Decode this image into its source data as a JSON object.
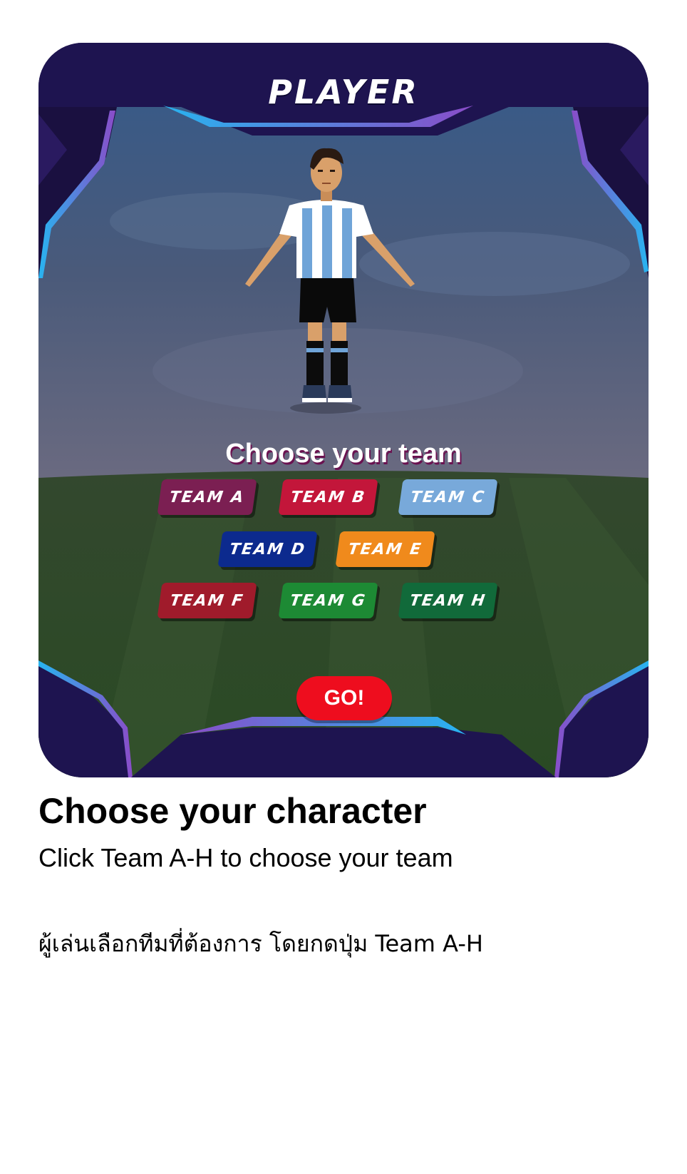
{
  "card": {
    "title": "PLAYER",
    "heading": "Choose your team",
    "teams": [
      {
        "label": "TEAM A",
        "color": "#7b1f52"
      },
      {
        "label": "TEAM B",
        "color": "#c3163a"
      },
      {
        "label": "TEAM C",
        "color": "#78a9da"
      },
      {
        "label": "TEAM D",
        "color": "#0c2a8e"
      },
      {
        "label": "TEAM E",
        "color": "#f08a1c"
      },
      {
        "label": "TEAM F",
        "color": "#a01b2b"
      },
      {
        "label": "TEAM G",
        "color": "#1d8a34"
      },
      {
        "label": "TEAM H",
        "color": "#116a3a"
      }
    ],
    "go_label": "GO!"
  },
  "caption": {
    "title": "Choose your character",
    "subtitle": "Click Team A-H to choose your team",
    "thai": "ผู้เล่นเลือกทีมที่ต้องการ โดยกดปุ่ม Team A-H"
  }
}
